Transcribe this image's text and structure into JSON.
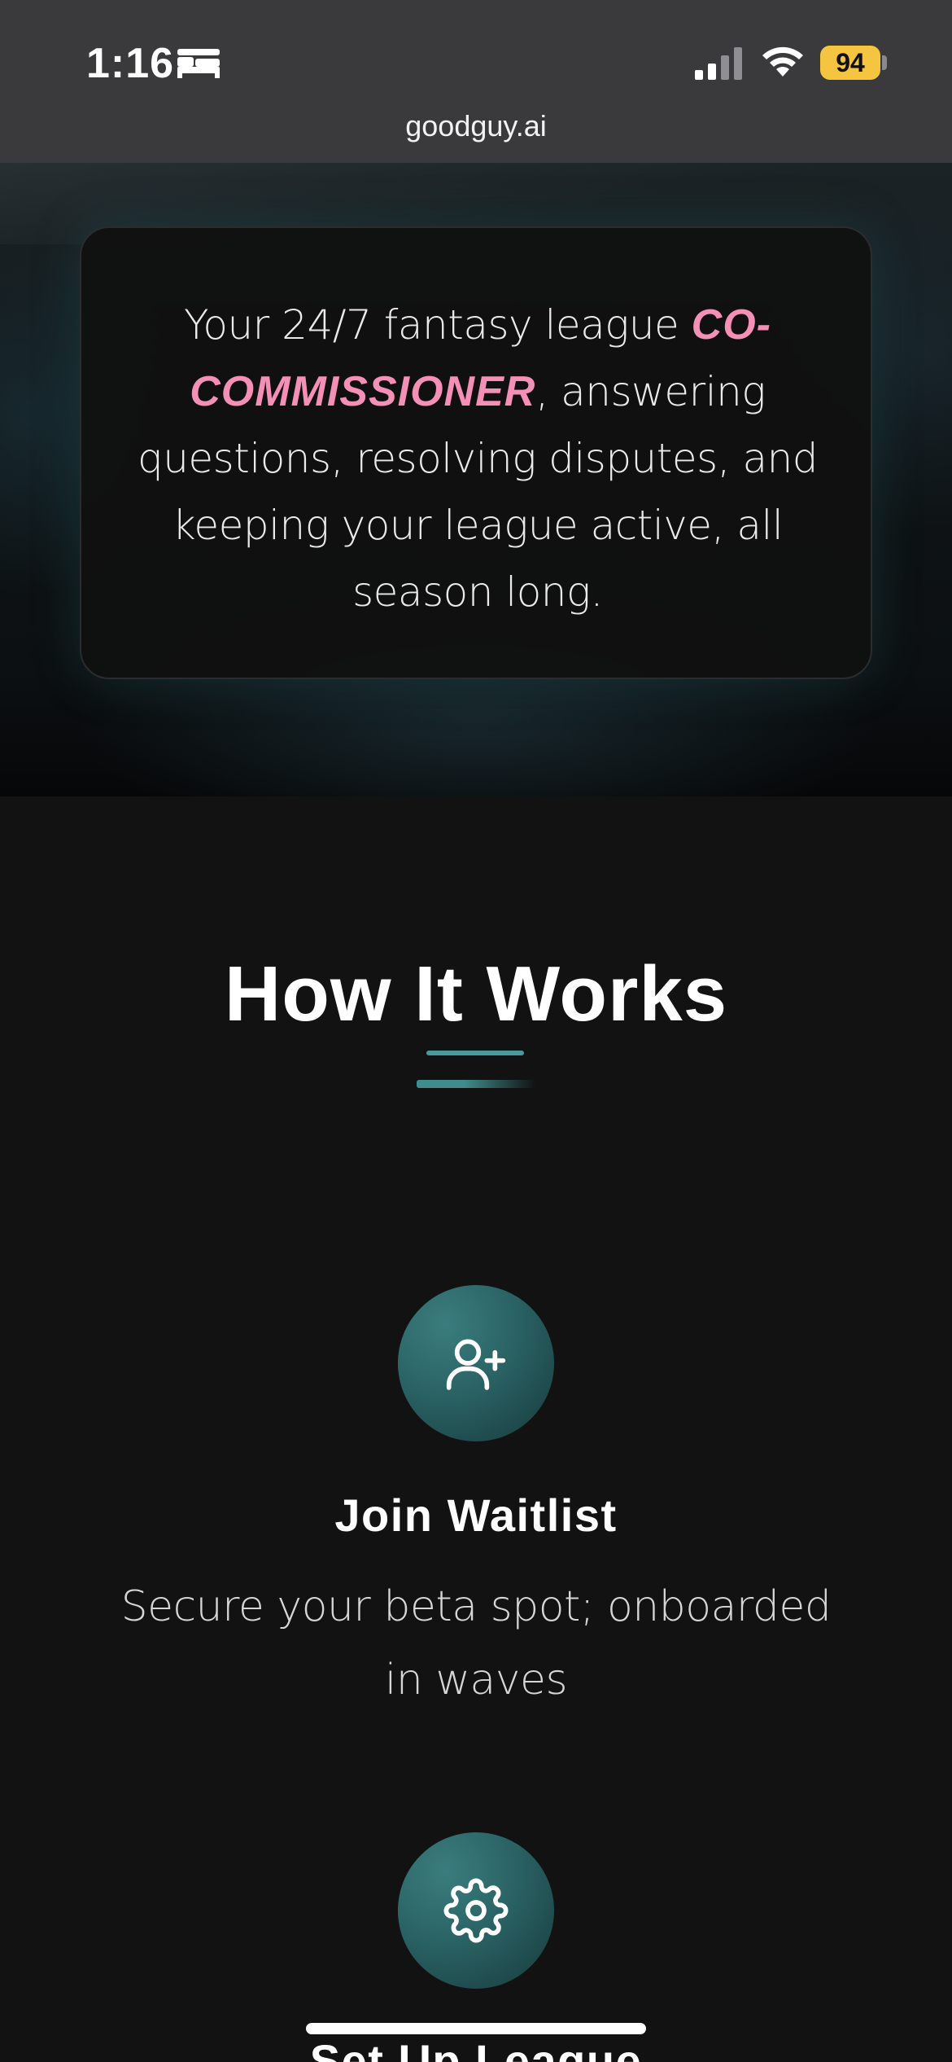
{
  "status_bar": {
    "time": "1:16",
    "battery": "94",
    "icons": [
      "bed-icon",
      "signal-icon",
      "wifi-icon",
      "battery-icon"
    ],
    "battery_color": "#f5c542"
  },
  "browser": {
    "url": "goodguy.ai"
  },
  "hero": {
    "text_before": "Your 24/7 fantasy league ",
    "accent": "CO-COMMISSIONER",
    "text_after": ", answering questions, resolving disputes, and keeping your league active, all season long.",
    "accent_color": "#f48fb6"
  },
  "how_it_works": {
    "title": "How It Works",
    "accent_color": "#4a9a9a",
    "steps": [
      {
        "icon": "user-plus-icon",
        "title": "Join Waitlist",
        "description": "Secure your beta spot; onboarded in waves"
      },
      {
        "icon": "gear-icon",
        "title": "Set Up League",
        "description": ""
      }
    ]
  }
}
